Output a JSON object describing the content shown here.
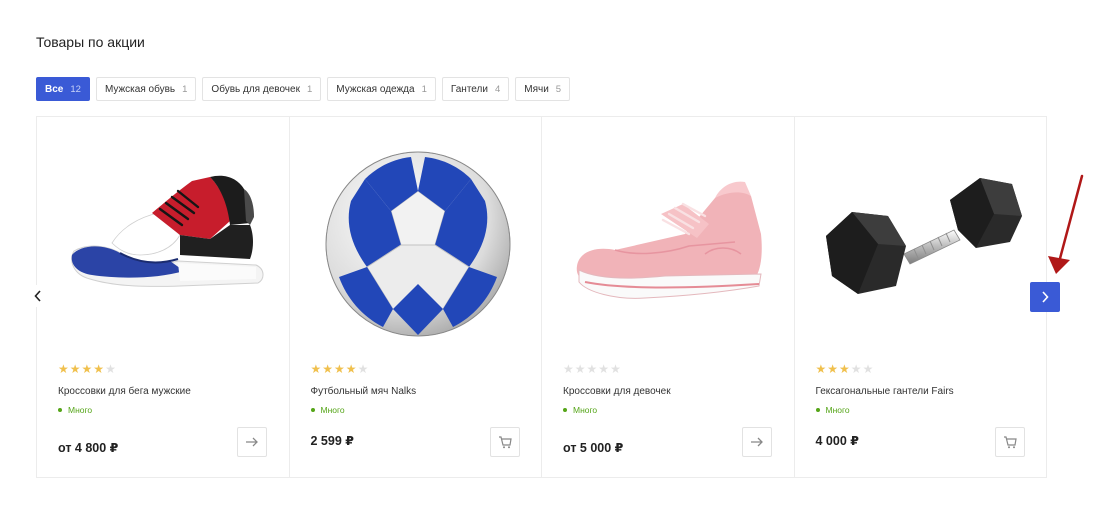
{
  "section": {
    "title": "Товары по акции"
  },
  "tabs": [
    {
      "label": "Все",
      "count": "12",
      "active": true
    },
    {
      "label": "Мужская обувь",
      "count": "1"
    },
    {
      "label": "Обувь для девочек",
      "count": "1"
    },
    {
      "label": "Мужская одежда",
      "count": "1"
    },
    {
      "label": "Гантели",
      "count": "4"
    },
    {
      "label": "Мячи",
      "count": "5"
    }
  ],
  "products": [
    {
      "name": "Кроссовки для бега мужские",
      "rating": 4,
      "stock": "Много",
      "price": "от 4 800 ₽",
      "action_icon": "arrow-right-icon"
    },
    {
      "name": "Футбольный мяч Nalks",
      "rating": 4,
      "stock": "Много",
      "price": "2 599 ₽",
      "action_icon": "cart-icon"
    },
    {
      "name": "Кроссовки для девочек",
      "rating": 0,
      "stock": "Много",
      "price": "от 5 000 ₽",
      "action_icon": "arrow-right-icon"
    },
    {
      "name": "Гексагональные гантели Fairs",
      "rating": 3,
      "stock": "Много",
      "price": "4 000 ₽",
      "action_icon": "cart-icon"
    }
  ],
  "nav": {
    "prev_icon": "chevron-left-icon",
    "next_icon": "chevron-right-icon"
  },
  "colors": {
    "accent": "#3a5ad6",
    "star": "#f0c04d",
    "stock": "#55a518",
    "annotation": "#b01818"
  }
}
